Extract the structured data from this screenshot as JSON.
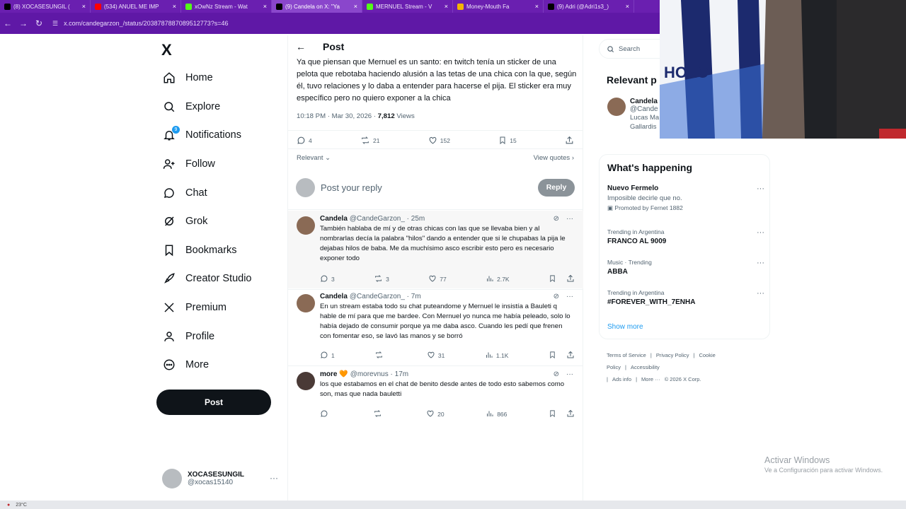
{
  "browser": {
    "tabs": [
      {
        "label": "(8) XOCASESUNGIL (",
        "icon": "x-icon",
        "color": "#000000"
      },
      {
        "label": "(534) ANUEL ME IMP",
        "icon": "youtube-icon",
        "color": "#ff0000"
      },
      {
        "label": "xOwNz Stream - Wat",
        "icon": "kick-icon",
        "color": "#53fc18"
      },
      {
        "label": "(9) Candela on X: \"Ya",
        "icon": "x-icon",
        "color": "#000000",
        "active": true
      },
      {
        "label": "MERNUEL Stream - V",
        "icon": "kick-icon",
        "color": "#53fc18"
      },
      {
        "label": "Money-Mouth Fa",
        "icon": "emoji-icon",
        "color": "#f4b400"
      },
      {
        "label": "(9) Adri (@Adri1s3_)",
        "icon": "x-icon",
        "color": "#000000"
      }
    ],
    "url": "x.com/candegarzon_/status/2038787887089512773?s=46"
  },
  "nav": {
    "logo": "X",
    "items": [
      {
        "label": "Home",
        "icon": "home-icon",
        "name": "home"
      },
      {
        "label": "Explore",
        "icon": "search-icon",
        "name": "explore"
      },
      {
        "label": "Notifications",
        "icon": "bell-icon",
        "name": "notifications",
        "badge": "9"
      },
      {
        "label": "Follow",
        "icon": "add-person-icon",
        "name": "follow"
      },
      {
        "label": "Chat",
        "icon": "chat-icon",
        "name": "chat"
      },
      {
        "label": "Grok",
        "icon": "grok-icon",
        "name": "grok"
      },
      {
        "label": "Bookmarks",
        "icon": "bookmark-icon",
        "name": "bookmarks"
      },
      {
        "label": "Creator Studio",
        "icon": "rocket-icon",
        "name": "creator-studio"
      },
      {
        "label": "Premium",
        "icon": "x-logo-icon",
        "name": "premium"
      },
      {
        "label": "Profile",
        "icon": "person-icon",
        "name": "profile"
      },
      {
        "label": "More",
        "icon": "more-circle-icon",
        "name": "more"
      }
    ],
    "post_label": "Post",
    "account": {
      "name": "XOCASESUNGIL",
      "handle": "@xocas15140"
    }
  },
  "post": {
    "header_title": "Post",
    "text": "Ya que piensan que Mernuel es un santo: en twitch tenía un sticker de una pelota que rebotaba haciendo alusión a las tetas de una chica con la que, según él, tuvo relaciones y lo daba a entender para hacerse el pija. El sticker era muy específico pero no quiero exponer a la chica",
    "time": "10:18 PM · Mar 30, 2026 · ",
    "views": "7,812",
    "views_label": " Views",
    "replies": "4",
    "reposts": "21",
    "likes": "152",
    "bookmarks": "15",
    "sort_label": "Relevant",
    "view_quotes": "View quotes",
    "reply_placeholder": "Post your reply",
    "reply_button": "Reply"
  },
  "replies": [
    {
      "name": "Candela",
      "handle": "@CandeGarzon_ · 25m",
      "text": "También hablaba de mí y de otras chicas con las que se llevaba bien y al nombrarlas decía la palabra \"hilos\" dando a entender que si le chupabas la pija le dejabas hilos de baba. Me da muchísimo asco escribir esto pero es necesario exponer todo",
      "replies": "3",
      "reposts": "3",
      "likes": "77",
      "views": "2.7K",
      "avatar_color": "#8a6a55"
    },
    {
      "name": "Candela",
      "handle": "@CandeGarzon_ · 7m",
      "text": "En un stream estaba todo su chat puteandome y Mernuel le insistía a Bauleti q hable de mí para que me bardee. Con Mernuel yo nunca me había peleado, solo lo había dejado de consumir porque ya me daba asco. Cuando les pedí que frenen con fomentar eso, se lavó las manos y se borró",
      "replies": "1",
      "reposts": "",
      "likes": "31",
      "views": "1.1K",
      "avatar_color": "#8a6a55"
    },
    {
      "name": "more 🧡",
      "handle": "@morevnus · 17m",
      "text": "los que estabamos en el chat de benito desde antes de todo esto sabemos como son, mas que nada bauletti",
      "replies": "",
      "reposts": "",
      "likes": "20",
      "views": "866",
      "avatar_color": "#4a3a36"
    }
  ],
  "sidebar": {
    "search_placeholder": "Search",
    "relevant_title": "Relevant p",
    "relevant_user": {
      "name": "Candela",
      "handle": "@Cande",
      "bio1": "Lucas Ma",
      "bio2": "Gallardis"
    },
    "happening_title": "What's happening",
    "trends": [
      {
        "context": "",
        "name": "Nuevo Fermelo",
        "sub": "Imposible decirle que no.",
        "promo": "Promoted by Fernet 1882"
      },
      {
        "context": "Trending in Argentina",
        "name": "FRANCO AL 9009",
        "sub": "",
        "promo": ""
      },
      {
        "context": "Music · Trending",
        "name": "ABBA",
        "sub": "",
        "promo": ""
      },
      {
        "context": "Trending in Argentina",
        "name": "#FOREVER_WITH_7ENHA",
        "sub": "",
        "promo": ""
      }
    ],
    "show_more": "Show more",
    "footer": [
      "Terms of Service",
      "|",
      "Privacy Policy",
      "|",
      "Cookie Policy",
      "|",
      "Accessibility",
      "|",
      "Ads info",
      "|",
      "More ···",
      "© 2026 X Corp."
    ]
  },
  "overlay": {
    "activate_title": "Activar Windows",
    "activate_sub": "Ve a Configuración para activar Windows.",
    "taskbar_temp": "23°C",
    "jersey_text": "HOLC"
  }
}
